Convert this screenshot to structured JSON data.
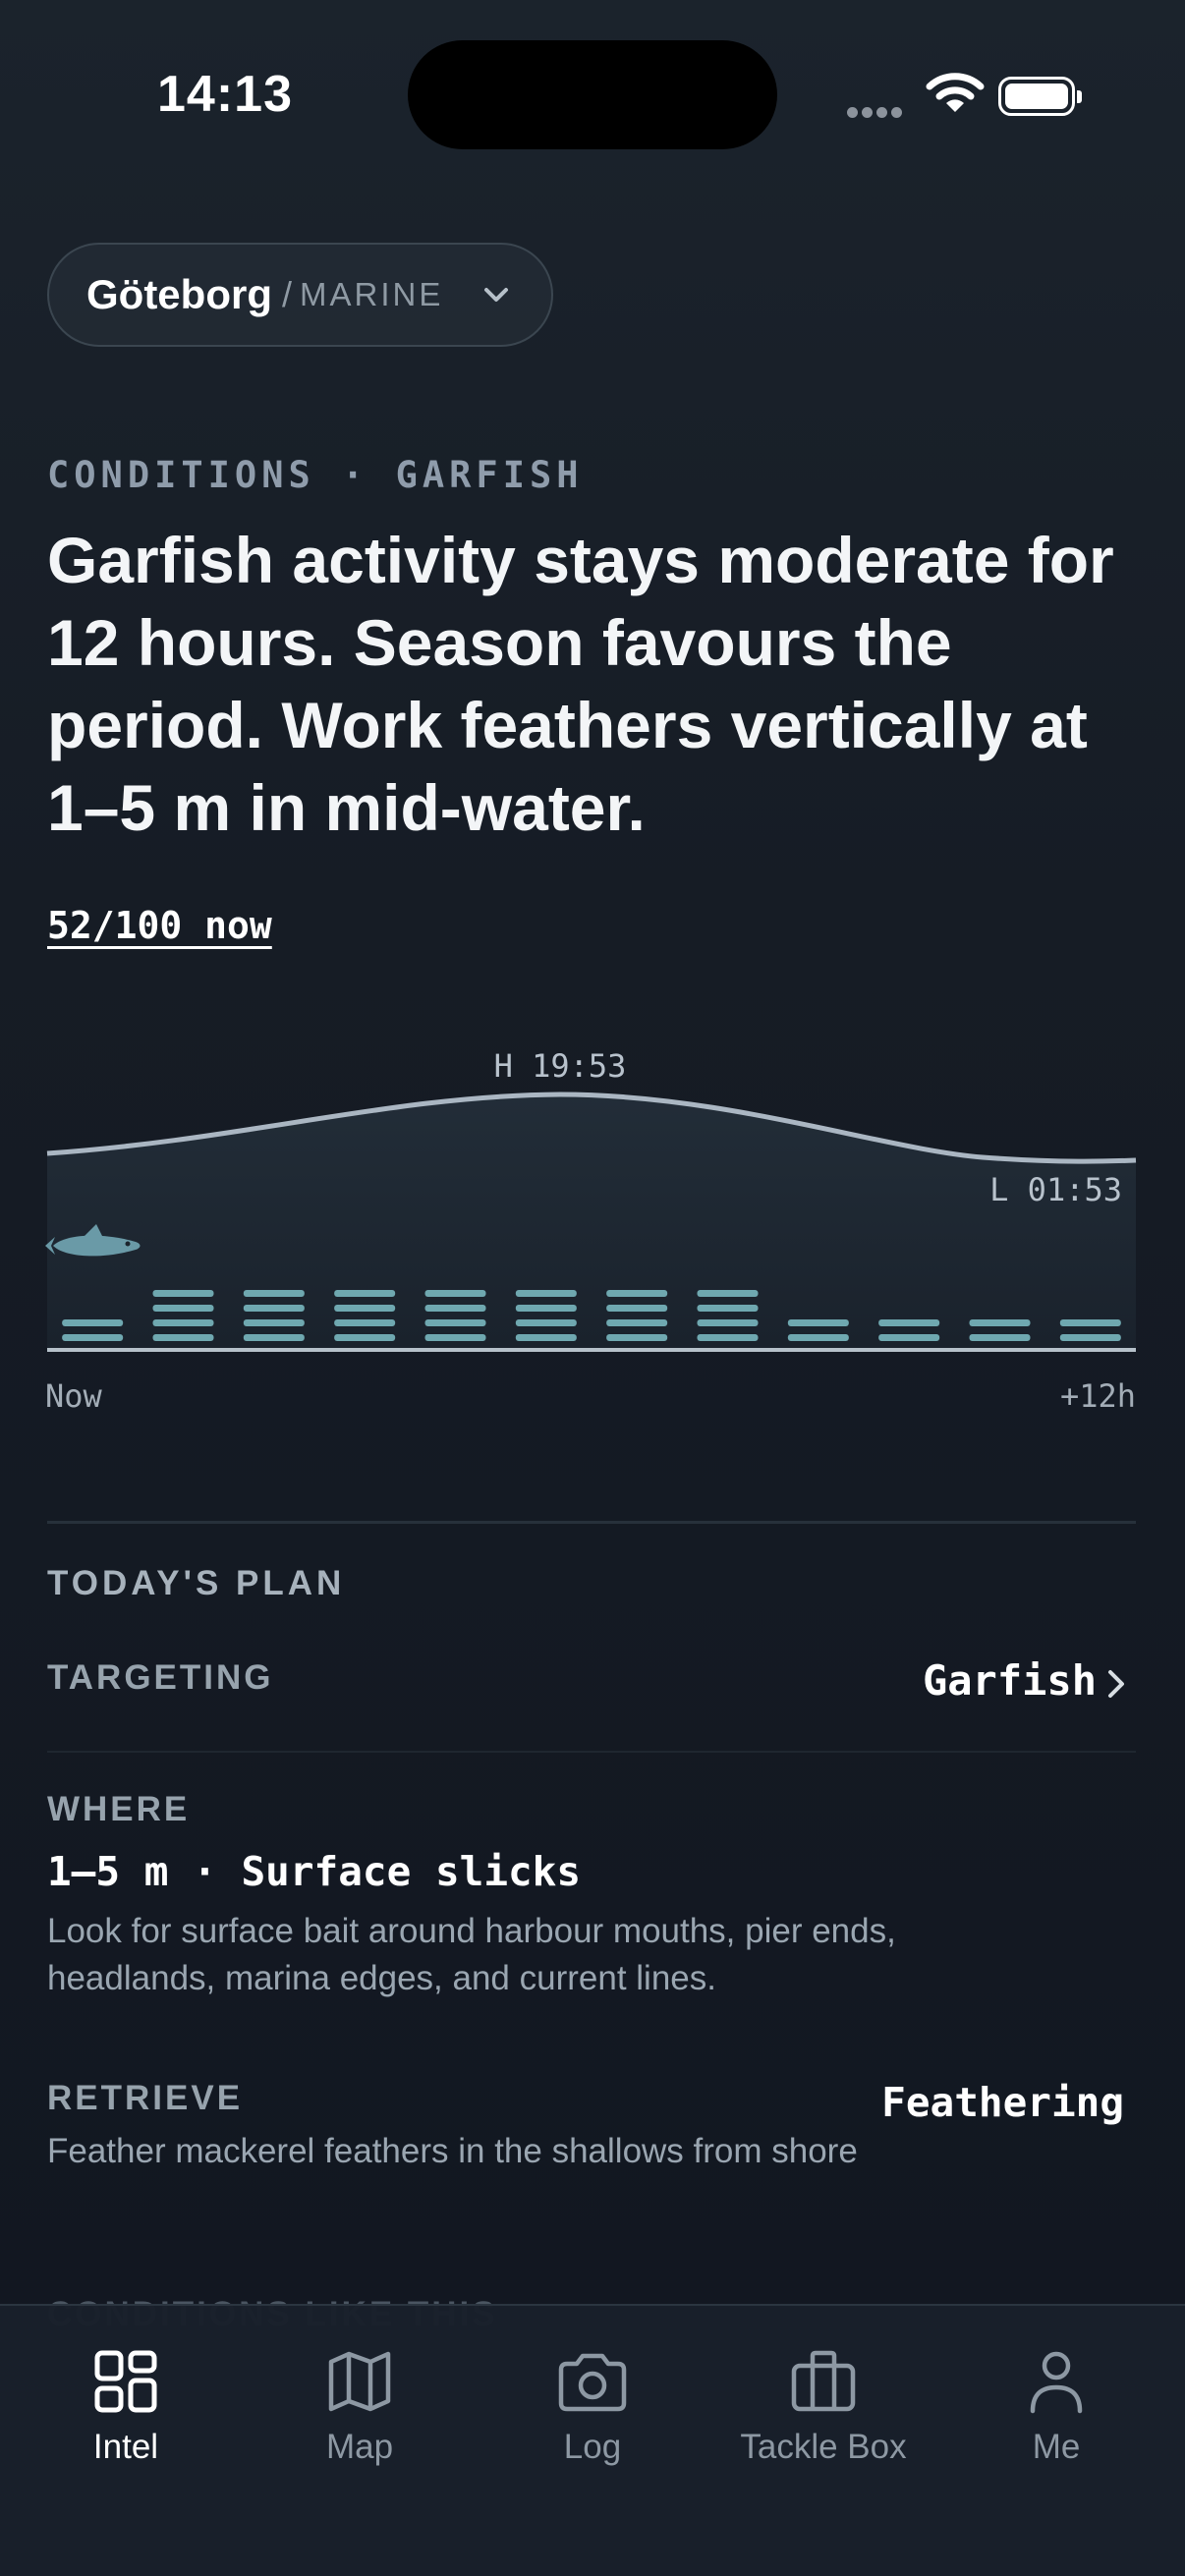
{
  "status_bar": {
    "time": "14:13"
  },
  "location": {
    "city": "Göteborg",
    "separator": "/",
    "type": "MARINE"
  },
  "conditions": {
    "eyebrow": "CONDITIONS · GARFISH",
    "headline": "Garfish activity stays moderate for 12 hours. Season favours the period. Work feathers vertically at 1–5 m in mid-water.",
    "score": "52/100 now"
  },
  "chart_data": {
    "type": "bar",
    "tide_high_label": "H 19:53",
    "tide_low_label": "L 01:53",
    "x_start_label": "Now",
    "x_end_label": "+12h",
    "activity_levels": [
      2,
      4,
      4,
      4,
      4,
      4,
      4,
      4,
      2,
      2,
      2,
      2
    ]
  },
  "plan": {
    "title": "TODAY'S PLAN",
    "targeting": {
      "label": "TARGETING",
      "value": "Garfish"
    },
    "where": {
      "label": "WHERE",
      "value": "1–5 m · Surface slicks",
      "description": "Look for surface bait around harbour mouths, pier ends, headlands, marina edges, and current lines."
    },
    "retrieve": {
      "label": "RETRIEVE",
      "value": "Feathering",
      "description": "Feather mackerel feathers in the shallows from shore"
    },
    "next_section": "CONDITIONS LIKE THIS"
  },
  "tabs": [
    {
      "label": "Intel",
      "icon": "grid-icon",
      "active": true
    },
    {
      "label": "Map",
      "icon": "map-icon",
      "active": false
    },
    {
      "label": "Log",
      "icon": "camera-icon",
      "active": false
    },
    {
      "label": "Tackle Box",
      "icon": "briefcase-icon",
      "active": false
    },
    {
      "label": "Me",
      "icon": "person-icon",
      "active": false
    }
  ],
  "colors": {
    "accent": "#6fa8b0",
    "background": "#161c25"
  }
}
